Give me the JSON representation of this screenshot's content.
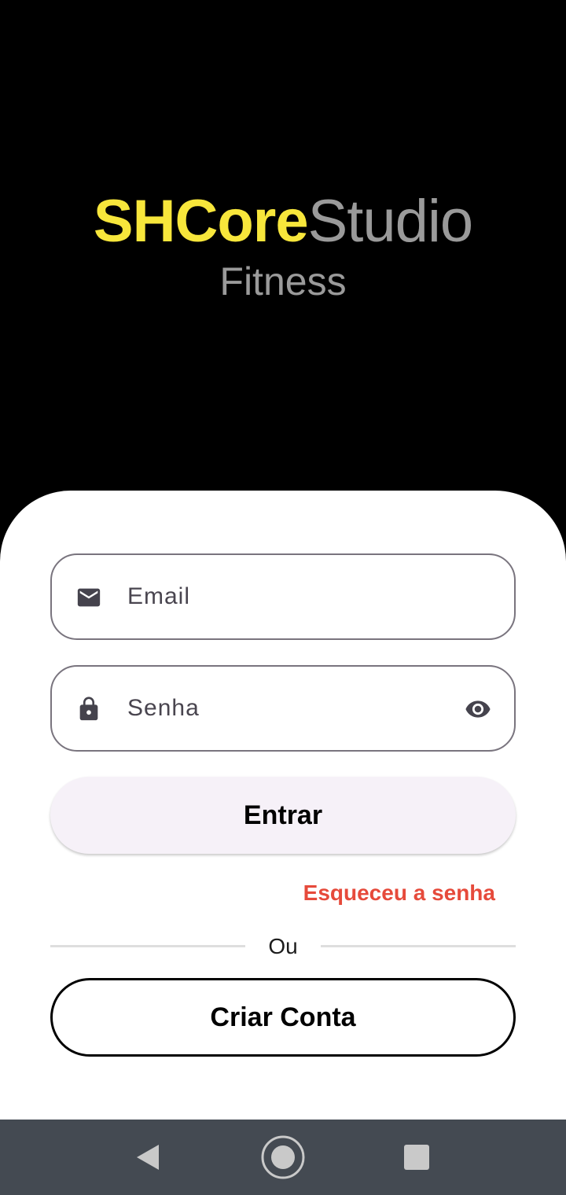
{
  "brand": {
    "title_strong": "SHCore",
    "title_light": "Studio",
    "subtitle": "Fitness"
  },
  "colors": {
    "brand_accent": "#F7E63B",
    "brand_muted": "#9A9A9A",
    "link_red": "#E64A3B",
    "button_fill": "#F6F1F8",
    "navbar": "#444A52"
  },
  "login_form": {
    "email": {
      "placeholder": "Email",
      "icon": "mail-icon"
    },
    "password": {
      "placeholder": "Senha",
      "icon": "lock-icon",
      "toggle_icon": "eye-icon"
    },
    "submit_label": "Entrar",
    "forgot_label": "Esqueceu a senha",
    "divider_label": "Ou",
    "create_label": "Criar Conta"
  },
  "navbar": {
    "back_icon": "back-triangle-icon",
    "home_icon": "home-circle-icon",
    "recent_icon": "recents-square-icon"
  }
}
